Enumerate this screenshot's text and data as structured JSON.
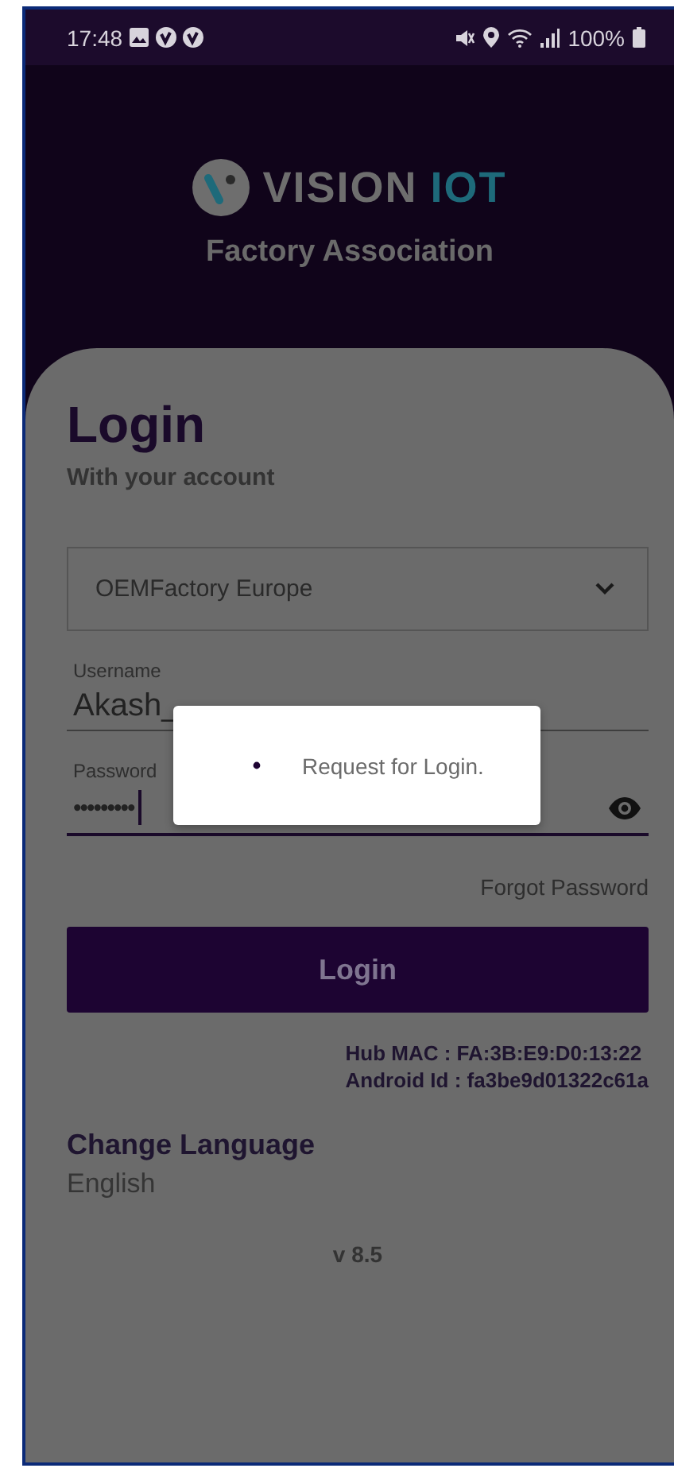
{
  "status_bar": {
    "time": "17:48",
    "battery": "100%"
  },
  "header": {
    "brand_main": "VISION",
    "brand_accent": "IOT",
    "subtitle": "Factory Association"
  },
  "login": {
    "title": "Login",
    "subtitle": "With your account",
    "factory_select": {
      "value": "OEMFactory Europe"
    },
    "username": {
      "label": "Username",
      "value": "Akash_"
    },
    "password": {
      "label": "Password",
      "value": "•••••••••"
    },
    "forgot": "Forgot Password",
    "button": "Login",
    "hub_mac": "Hub MAC : FA:3B:E9:D0:13:22",
    "android_id": "Android Id : fa3be9d01322c61a",
    "language": {
      "title": "Change Language",
      "value": "English"
    },
    "version": "v 8.5"
  },
  "dialog": {
    "message": "Request for Login."
  }
}
